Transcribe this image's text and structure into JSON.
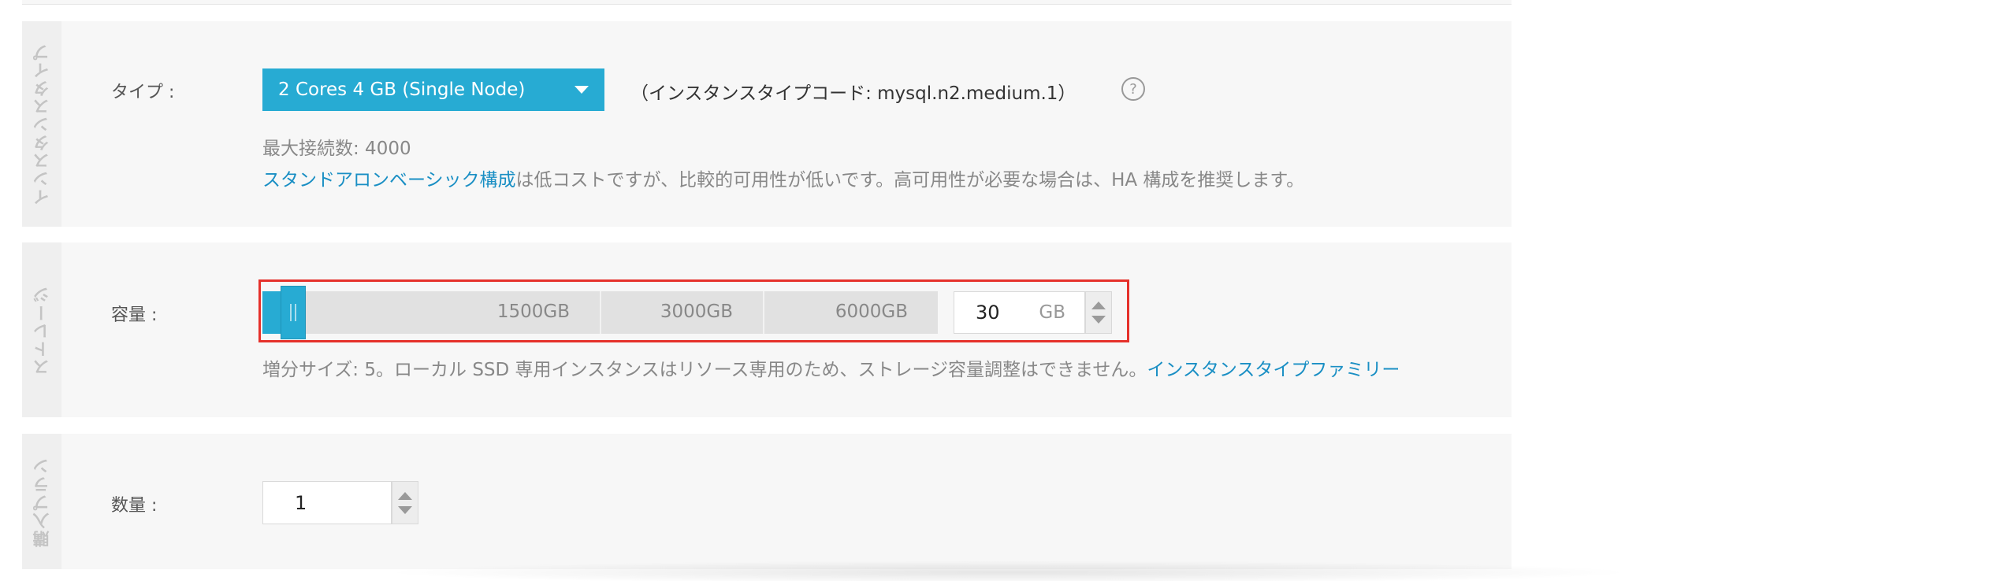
{
  "sections": {
    "instance_type": {
      "tab_label": "インスタンスタイプ",
      "type_label": "タイプ :",
      "selected_type": "2 Cores 4 GB (Single Node)",
      "type_code": "（インスタンスタイプコード: mysql.n2.medium.1）",
      "help_icon": "?",
      "max_connections": "最大接続数:  4000",
      "note_link": "スタンドアロンベーシック構成",
      "note_text": "は低コストですが、比較的可用性が低いです。高可用性が必要な場合は、HA 構成を推奨します。"
    },
    "storage": {
      "tab_label": "ストレージ",
      "capacity_label": "容量 :",
      "slider_marks": [
        "1500GB",
        "3000GB",
        "6000GB"
      ],
      "slider_value_fraction": 0.005,
      "capacity_value": "30",
      "unit": "GB",
      "note_text": "増分サイズ:  5。ローカル SSD 専用インスタンスはリソース専用のため、ストレージ容量調整はできません。",
      "note_link": "インスタンスタイプファミリー"
    },
    "purchase_plan": {
      "tab_label": "購入プラン",
      "quantity_label": "数量 :",
      "quantity_value": "1"
    }
  },
  "colors": {
    "accent": "#27abd3",
    "link": "#1a8fc4",
    "highlight_border": "#e5312b"
  },
  "icons": {
    "dropdown": "caret-down-icon",
    "help": "question-circle-icon",
    "stepper_up": "triangle-up-icon",
    "stepper_down": "triangle-down-icon"
  }
}
